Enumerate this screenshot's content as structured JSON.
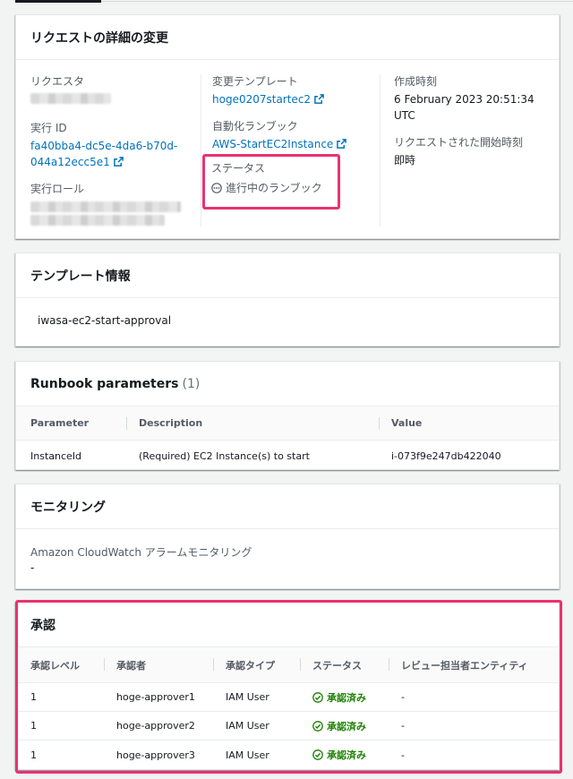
{
  "details": {
    "title": "リクエストの詳細の変更",
    "requester_label": "リクエスタ",
    "execution_id_label": "実行 ID",
    "execution_id_line1": "fa40bba4-dc5e-4da6-b70d-",
    "execution_id_line2": "044a12ecc5e1",
    "execution_role_label": "実行ロール",
    "template_label": "変更テンプレート",
    "template_value": "hoge0207startec2",
    "runbook_label": "自動化ランブック",
    "runbook_value": "AWS-StartEC2Instance",
    "status_label": "ステータス",
    "status_value": "進行中のランブック",
    "created_label": "作成時刻",
    "created_value": "6 February 2023 20:51:34 UTC",
    "start_label": "リクエストされた開始時刻",
    "start_value": "即時"
  },
  "template_info": {
    "title": "テンプレート情報",
    "name": "iwasa-ec2-start-approval"
  },
  "runbook_params": {
    "title": "Runbook parameters",
    "count": "(1)",
    "headers": [
      "Parameter",
      "Description",
      "Value"
    ],
    "rows": [
      [
        "InstanceId",
        "(Required) EC2 Instance(s) to start",
        "i-073f9e247db422040"
      ]
    ]
  },
  "monitoring": {
    "title": "モニタリング",
    "label": "Amazon CloudWatch アラームモニタリング",
    "value": "-"
  },
  "approval": {
    "title": "承認",
    "headers": [
      "承認レベル",
      "承認者",
      "承認タイプ",
      "ステータス",
      "レビュー担当者エンティティ"
    ],
    "rows": [
      {
        "level": "1",
        "approver": "hoge-approver1",
        "type": "IAM User",
        "status": "承認済み",
        "entity": "-"
      },
      {
        "level": "1",
        "approver": "hoge-approver2",
        "type": "IAM User",
        "status": "承認済み",
        "entity": "-"
      },
      {
        "level": "1",
        "approver": "hoge-approver3",
        "type": "IAM User",
        "status": "承認済み",
        "entity": "-"
      }
    ]
  },
  "colors": {
    "link": "#0073bb",
    "success": "#1d8102",
    "highlight": "#e8336f"
  }
}
